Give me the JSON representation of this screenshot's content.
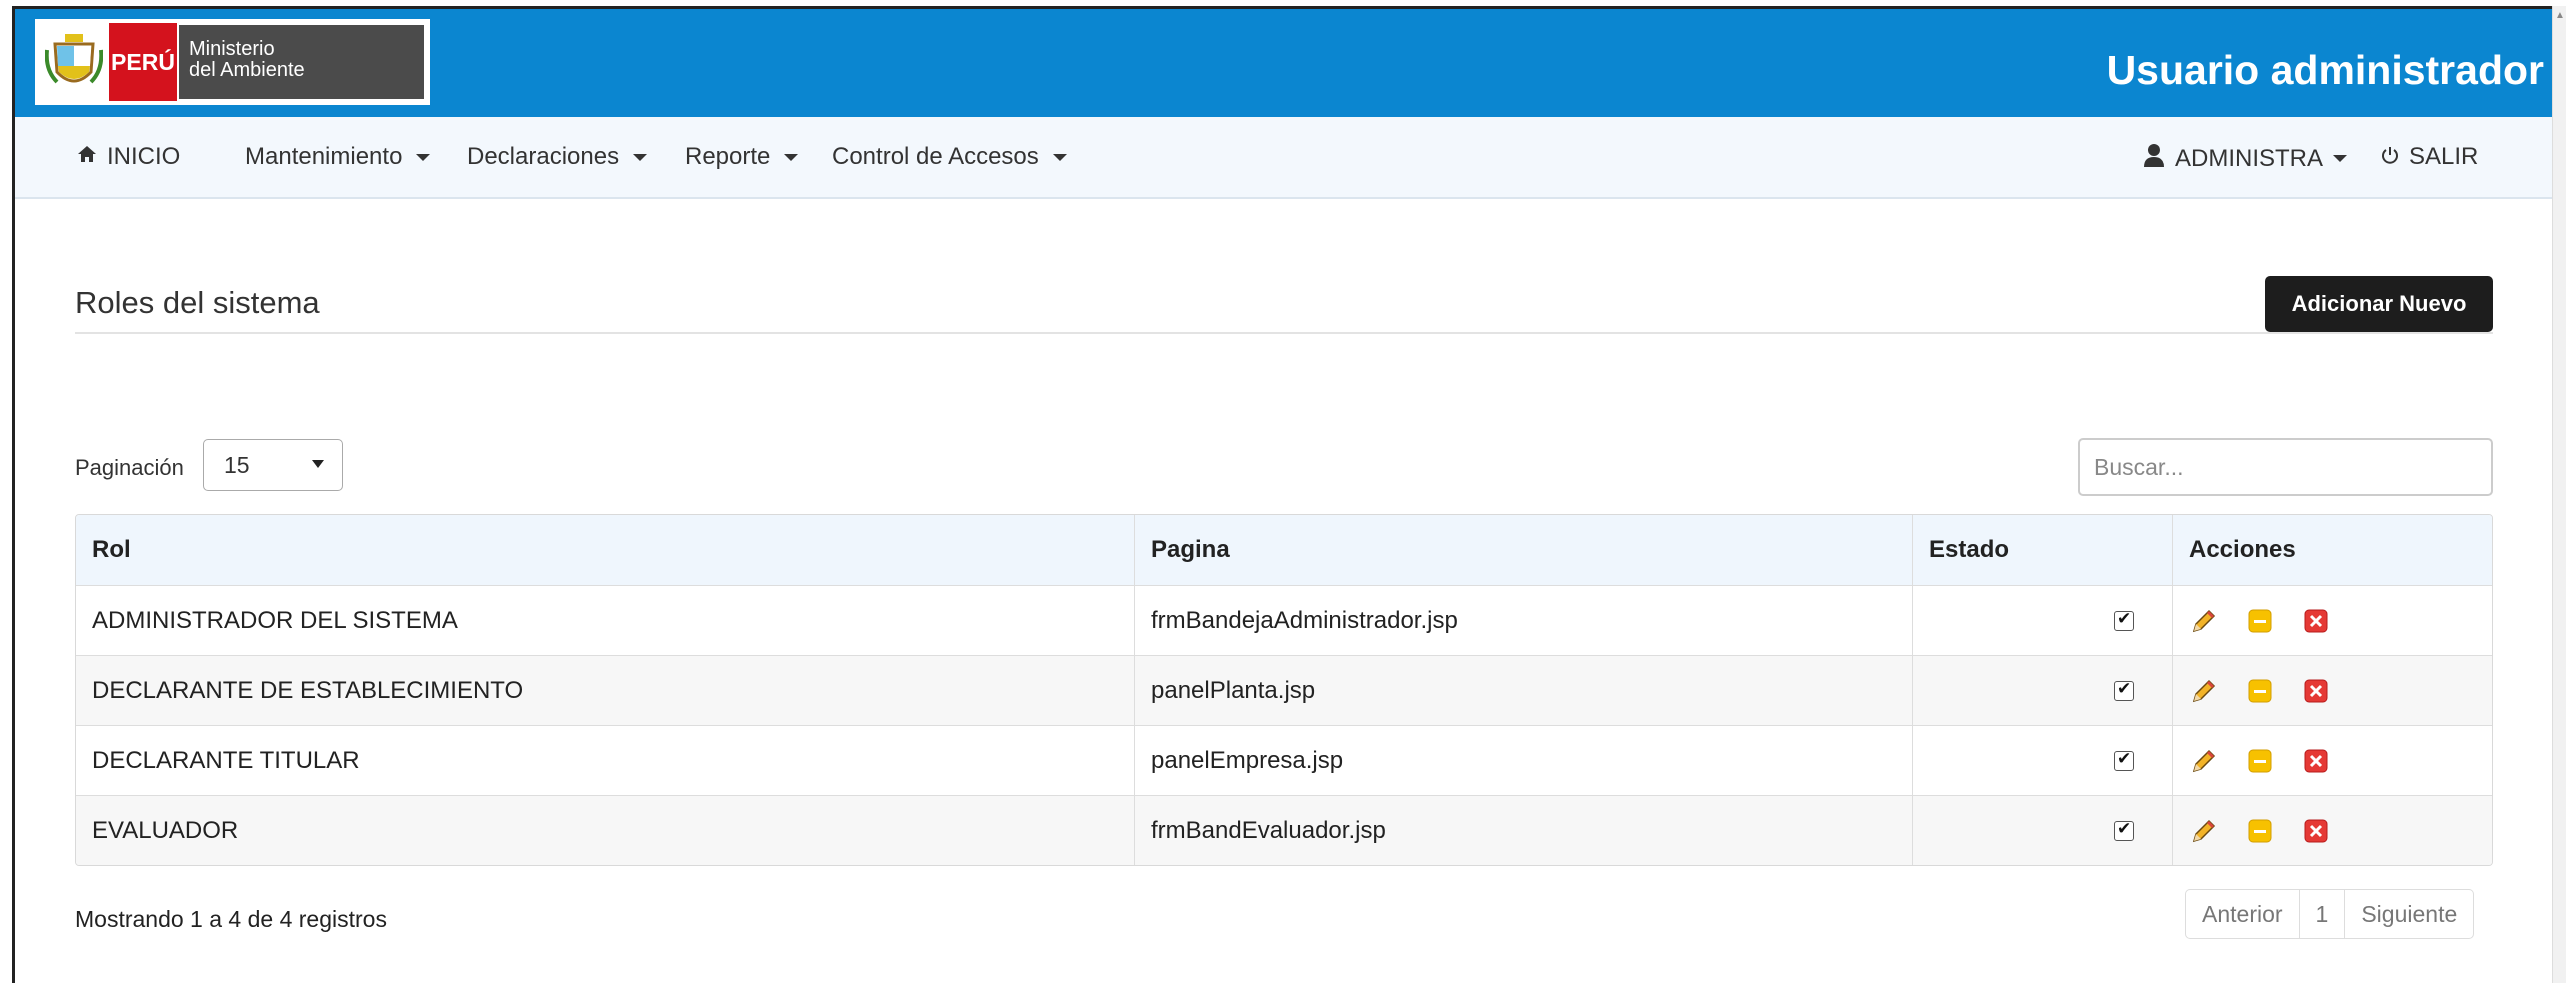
{
  "header": {
    "logo_country": "PERÚ",
    "logo_ministry_line1": "Ministerio",
    "logo_ministry_line2": "del Ambiente",
    "title": "Usuario administrador",
    "color": "#0b86d0"
  },
  "nav": {
    "home": "INICIO",
    "menus": [
      "Mantenimiento",
      "Declaraciones",
      "Reporte",
      "Control de Accesos"
    ],
    "user": "ADMINISTRA",
    "logout": "SALIR"
  },
  "page": {
    "title": "Roles del sistema",
    "add_button": "Adicionar Nuevo"
  },
  "pagination": {
    "label": "Paginación",
    "selected": "15"
  },
  "search": {
    "placeholder": "Buscar..."
  },
  "table": {
    "columns": [
      "Rol",
      "Pagina",
      "Estado",
      "Acciones"
    ],
    "rows": [
      {
        "rol": "ADMINISTRADOR DEL SISTEMA",
        "pagina": "frmBandejaAdministrador.jsp",
        "estado": true
      },
      {
        "rol": "DECLARANTE DE ESTABLECIMIENTO",
        "pagina": "panelPlanta.jsp",
        "estado": true
      },
      {
        "rol": "DECLARANTE TITULAR",
        "pagina": "panelEmpresa.jsp",
        "estado": true
      },
      {
        "rol": "EVALUADOR",
        "pagina": "frmBandEvaluador.jsp",
        "estado": true
      }
    ],
    "action_icons": [
      "pencil-icon",
      "minus-box-icon",
      "close-box-icon"
    ]
  },
  "footer": {
    "showing": "Mostrando 1 a 4 de 4 registros",
    "prev": "Anterior",
    "page": "1",
    "next": "Siguiente"
  }
}
